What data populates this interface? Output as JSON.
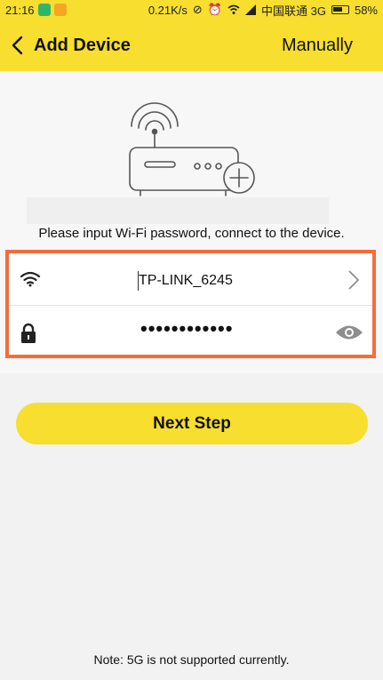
{
  "status_bar": {
    "time": "21:16",
    "speed": "0.21K/s",
    "carrier": "中国联通 3G",
    "battery": "58%"
  },
  "header": {
    "title": "Add Device",
    "manual_label": "Manually"
  },
  "form": {
    "prompt": "Please input Wi-Fi password, connect to the device.",
    "ssid": "TP-LINK_6245",
    "password_masked": "••••••••••••"
  },
  "actions": {
    "next_label": "Next Step"
  },
  "footer": {
    "note": "Note: 5G is not supported currently."
  },
  "colors": {
    "accent": "#f7de2f",
    "highlight_border": "#f56c3b"
  },
  "icons": [
    "back-icon",
    "router-illustration",
    "wifi-icon",
    "lock-icon",
    "chevron-right-icon",
    "eye-icon"
  ]
}
